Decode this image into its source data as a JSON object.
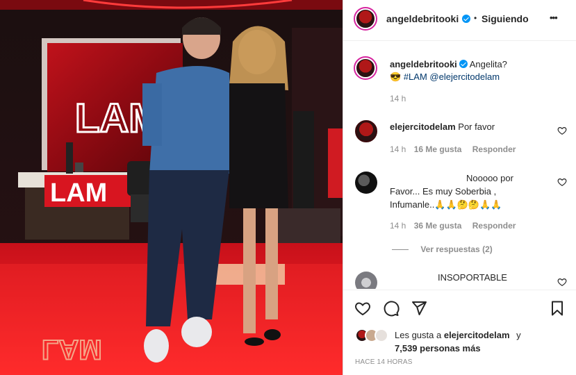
{
  "header": {
    "username": "angeldebritooki",
    "dot": "•",
    "follow_status": "Siguiendo",
    "more": "•••"
  },
  "caption": {
    "username": "angeldebritooki",
    "text": "Angelita?",
    "emoji": "😎",
    "hashtag": "#LAM",
    "mention": "@elejercitodelam",
    "time": "14 h"
  },
  "comments": [
    {
      "username": "elejercitodelam",
      "text": "Por favor",
      "time": "14 h",
      "likes": "16 Me gusta",
      "reply": "Responder"
    },
    {
      "username": "",
      "text": "Nooooo por Favor... Es muy Soberbia , Infumanle..🙏🙏🤔🤔🙏🙏",
      "line1": "Nooooo por",
      "line2": "Favor... Es muy Soberbia ,",
      "line3": "Infumanle..🙏🙏🤔🤔🙏🙏",
      "time": "14 h",
      "likes": "36 Me gusta",
      "reply": "Responder",
      "view_replies": "Ver respuestas (2)"
    },
    {
      "username": "",
      "text": "INSOPORTABLE"
    }
  ],
  "likes": {
    "line1_prefix": "Les gusta a",
    "line1_user": "elejercitodelam",
    "line1_suffix": "y",
    "line2": "7,539 personas más"
  },
  "posted": "HACE 14 HORAS",
  "photo": {
    "sign_top": "LAM",
    "sign_desk": "LAM",
    "sign_floor": "LAM",
    "accent": "#e3121b"
  }
}
